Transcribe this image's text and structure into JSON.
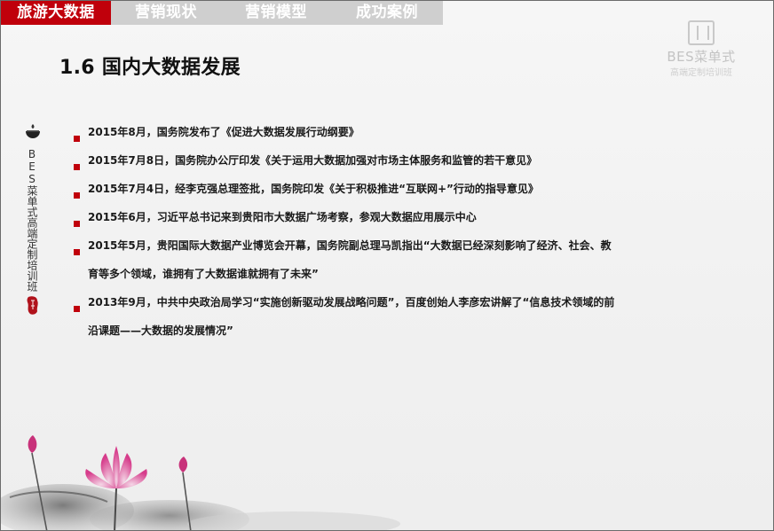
{
  "tabs": [
    {
      "label": "旅游大数据",
      "active": true
    },
    {
      "label": "营销现状",
      "active": false
    },
    {
      "label": "营销模型",
      "active": false
    },
    {
      "label": "成功案例",
      "active": false
    }
  ],
  "logo": {
    "brand": "BES菜单式",
    "sub": "高端定制培训班"
  },
  "title": "1.6 国内大数据发展",
  "sidebar": {
    "text": "BES菜单式高端定制培训班"
  },
  "bullets": [
    "2015年8月，国务院发布了《促进大数据发展行动纲要》",
    "2015年7月8日，国务院办公厅印发《关于运用大数据加强对市场主体服务和监管的若干意见》",
    "2015年7月4日，经李克强总理签批，国务院印发《关于积极推进“互联网+”行动的指导意见》",
    "2015年6月，习近平总书记来到贵阳市大数据广场考察，参观大数据应用展示中心",
    "2015年5月，贵阳国际大数据产业博览会开幕，国务院副总理马凯指出“大数据已经深刻影响了经济、社会、教育等多个领域，谁拥有了大数据谁就拥有了未来”",
    "2013年9月，中共中央政治局学习“实施创新驱动发展战略问题”，百度创始人李彦宏讲解了“信息技术领域的前沿课题——大数据的发展情况”"
  ],
  "colors": {
    "accent": "#c0000b",
    "tabbar": "#cfcfcf"
  }
}
